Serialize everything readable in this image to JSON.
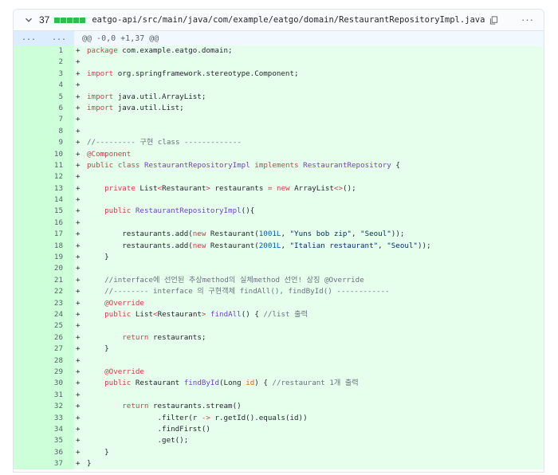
{
  "file": {
    "count": "37",
    "path": "eatgo-api/src/main/java/com/example/eatgo/domain/RestaurantRepositoryImpl.java",
    "diffstat_color": "#2cbe4e",
    "icons": [
      "chevron-down-icon",
      "copy-icon",
      "kebab-menu-icon"
    ],
    "menu_label": "···"
  },
  "hunk": {
    "expand_left": "...",
    "expand_right": "...",
    "header": "@@ -0,0 +1,37 @@"
  },
  "lines": [
    {
      "n": "1",
      "seg": [
        [
          "package",
          "k"
        ],
        [
          " com.example.eatgo.domain;",
          ""
        ]
      ]
    },
    {
      "n": "2",
      "seg": []
    },
    {
      "n": "3",
      "seg": [
        [
          "import",
          "k"
        ],
        [
          " org.springframework.stereotype.Component;",
          ""
        ]
      ]
    },
    {
      "n": "4",
      "seg": []
    },
    {
      "n": "5",
      "seg": [
        [
          "import",
          "k"
        ],
        [
          " java.util.ArrayList;",
          ""
        ]
      ]
    },
    {
      "n": "6",
      "seg": [
        [
          "import",
          "k"
        ],
        [
          " java.util.List;",
          ""
        ]
      ]
    },
    {
      "n": "7",
      "seg": []
    },
    {
      "n": "8",
      "seg": []
    },
    {
      "n": "9",
      "seg": [
        [
          "//--------- 구현 class -------------",
          "c"
        ]
      ]
    },
    {
      "n": "10",
      "seg": [
        [
          "@Component",
          "k"
        ]
      ]
    },
    {
      "n": "11",
      "seg": [
        [
          "public",
          "k"
        ],
        [
          " ",
          ""
        ],
        [
          "class",
          "k"
        ],
        [
          " ",
          ""
        ],
        [
          "RestaurantRepositoryImpl",
          "t"
        ],
        [
          " ",
          ""
        ],
        [
          "implements",
          "k"
        ],
        [
          " ",
          ""
        ],
        [
          "RestaurantRepository",
          "t"
        ],
        [
          " {",
          ""
        ]
      ]
    },
    {
      "n": "12",
      "seg": []
    },
    {
      "n": "13",
      "seg": [
        [
          "    ",
          ""
        ],
        [
          "private",
          "k"
        ],
        [
          " List",
          ""
        ],
        [
          "<",
          "k"
        ],
        [
          "Restaurant",
          ""
        ],
        [
          ">",
          "k"
        ],
        [
          " restaurants ",
          ""
        ],
        [
          "=",
          "k"
        ],
        [
          " ",
          ""
        ],
        [
          "new",
          "k"
        ],
        [
          " ArrayList",
          ""
        ],
        [
          "<>",
          "k"
        ],
        [
          "();",
          ""
        ]
      ]
    },
    {
      "n": "14",
      "seg": []
    },
    {
      "n": "15",
      "seg": [
        [
          "    ",
          ""
        ],
        [
          "public",
          "k"
        ],
        [
          " ",
          ""
        ],
        [
          "RestaurantRepositoryImpl",
          "t"
        ],
        [
          "(){",
          ""
        ]
      ]
    },
    {
      "n": "16",
      "seg": []
    },
    {
      "n": "17",
      "seg": [
        [
          "        restaurants.add(",
          ""
        ],
        [
          "new",
          "k"
        ],
        [
          " Restaurant(",
          ""
        ],
        [
          "1001L",
          "n"
        ],
        [
          ", ",
          ""
        ],
        [
          "\"Yuns bob zip\"",
          "s"
        ],
        [
          ", ",
          ""
        ],
        [
          "\"Seoul\"",
          "s"
        ],
        [
          "));",
          ""
        ]
      ]
    },
    {
      "n": "18",
      "seg": [
        [
          "        restaurants.add(",
          ""
        ],
        [
          "new",
          "k"
        ],
        [
          " Restaurant(",
          ""
        ],
        [
          "2001L",
          "n"
        ],
        [
          ", ",
          ""
        ],
        [
          "\"Italian restaurant\"",
          "s"
        ],
        [
          ", ",
          ""
        ],
        [
          "\"Seoul\"",
          "s"
        ],
        [
          "));",
          ""
        ]
      ]
    },
    {
      "n": "19",
      "seg": [
        [
          "    }",
          ""
        ]
      ]
    },
    {
      "n": "20",
      "seg": []
    },
    {
      "n": "21",
      "seg": [
        [
          "    //interface에 선언된 추상method의 실체method 선언! 상징 @Override",
          "c"
        ]
      ]
    },
    {
      "n": "22",
      "seg": [
        [
          "    //-------- interface 의 구현객체 findAll(), findById() ------------",
          "c"
        ]
      ]
    },
    {
      "n": "23",
      "seg": [
        [
          "    ",
          ""
        ],
        [
          "@Override",
          "k"
        ]
      ]
    },
    {
      "n": "24",
      "seg": [
        [
          "    ",
          ""
        ],
        [
          "public",
          "k"
        ],
        [
          " List",
          ""
        ],
        [
          "<",
          "k"
        ],
        [
          "Restaurant",
          ""
        ],
        [
          ">",
          "k"
        ],
        [
          " ",
          ""
        ],
        [
          "findAll",
          "t"
        ],
        [
          "() { ",
          ""
        ],
        [
          "//list 출력",
          "c"
        ]
      ]
    },
    {
      "n": "25",
      "seg": []
    },
    {
      "n": "26",
      "seg": [
        [
          "        ",
          ""
        ],
        [
          "return",
          "k"
        ],
        [
          " restaurants;",
          ""
        ]
      ]
    },
    {
      "n": "27",
      "seg": [
        [
          "    }",
          ""
        ]
      ]
    },
    {
      "n": "28",
      "seg": []
    },
    {
      "n": "29",
      "seg": [
        [
          "    ",
          ""
        ],
        [
          "@Override",
          "k"
        ]
      ]
    },
    {
      "n": "30",
      "seg": [
        [
          "    ",
          ""
        ],
        [
          "public",
          "k"
        ],
        [
          " Restaurant ",
          ""
        ],
        [
          "findById",
          "t"
        ],
        [
          "(Long ",
          ""
        ],
        [
          "id",
          "a"
        ],
        [
          ") { ",
          ""
        ],
        [
          "//restaurant 1개 출력",
          "c"
        ]
      ]
    },
    {
      "n": "31",
      "seg": []
    },
    {
      "n": "32",
      "seg": [
        [
          "        ",
          ""
        ],
        [
          "return",
          "k"
        ],
        [
          " restaurants.stream()",
          ""
        ]
      ]
    },
    {
      "n": "33",
      "seg": [
        [
          "                .filter(r ",
          ""
        ],
        [
          "->",
          "k"
        ],
        [
          " r.getId().equals(id))",
          ""
        ]
      ]
    },
    {
      "n": "34",
      "seg": [
        [
          "                .findFirst()",
          ""
        ]
      ]
    },
    {
      "n": "35",
      "seg": [
        [
          "                .get();",
          ""
        ]
      ]
    },
    {
      "n": "36",
      "seg": [
        [
          "    }",
          ""
        ]
      ]
    },
    {
      "n": "37",
      "seg": [
        [
          "}",
          ""
        ]
      ]
    }
  ],
  "add_marker": "+"
}
